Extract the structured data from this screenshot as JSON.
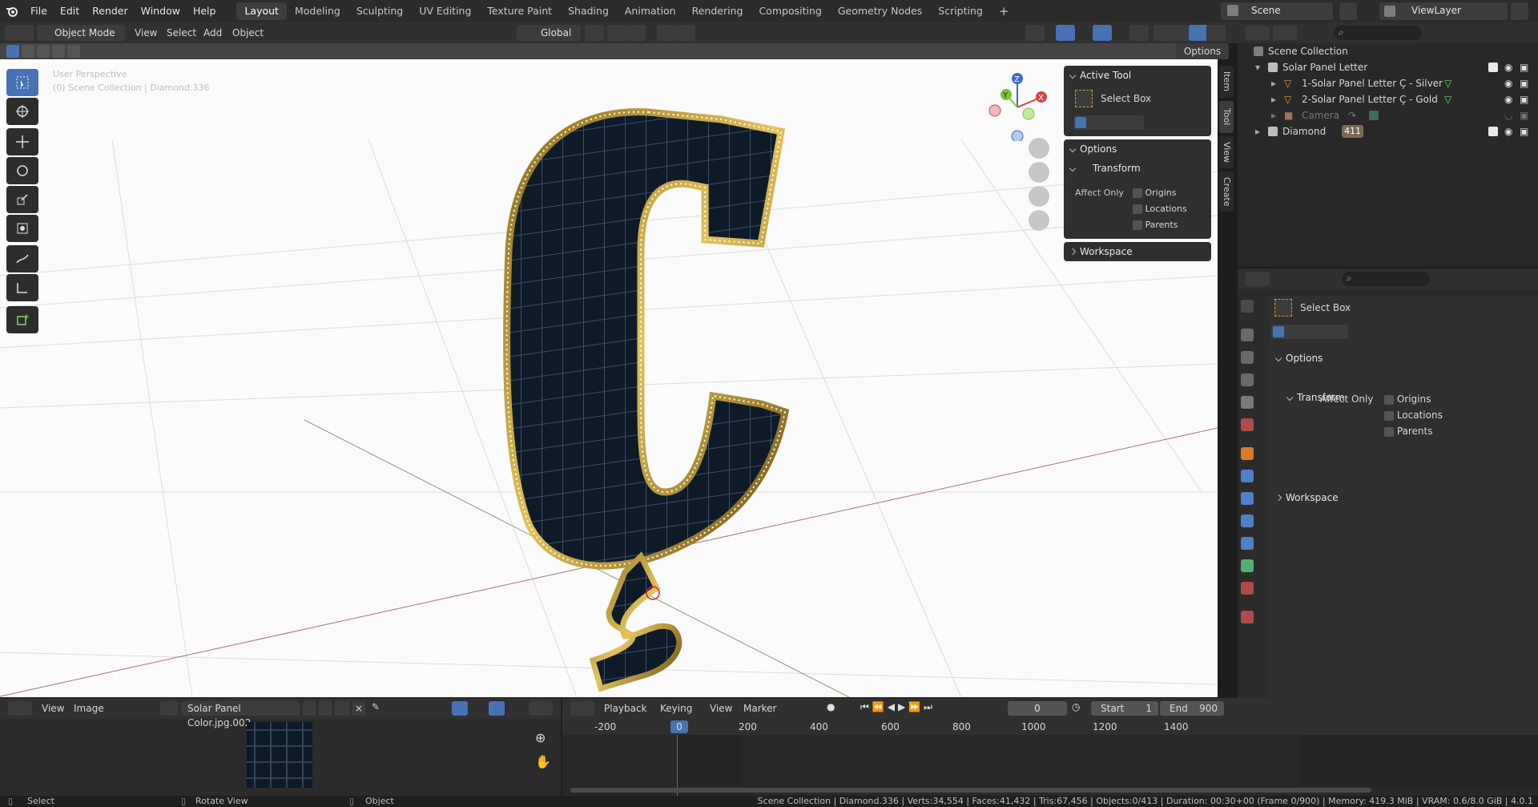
{
  "menubar": {
    "items": [
      "File",
      "Edit",
      "Render",
      "Window",
      "Help"
    ],
    "workspaces": [
      "Layout",
      "Modeling",
      "Sculpting",
      "UV Editing",
      "Texture Paint",
      "Shading",
      "Animation",
      "Rendering",
      "Compositing",
      "Geometry Nodes",
      "Scripting"
    ],
    "active_workspace": "Layout",
    "scene": "Scene",
    "view_layer": "ViewLayer"
  },
  "viewport_header": {
    "mode": "Object Mode",
    "menus": [
      "View",
      "Select",
      "Add",
      "Object"
    ],
    "orientation": "Global",
    "options_label": "Options"
  },
  "viewport": {
    "perspective_label": "User Perspective",
    "collection_label": "(0) Scene Collection | Diamond.336",
    "gizmo_axes": [
      "Z",
      "Y",
      "X"
    ]
  },
  "npanel": {
    "active_tool_header": "Active Tool",
    "tool_name": "Select Box",
    "options_header": "Options",
    "transform_header": "Transform",
    "affect_only": "Affect Only",
    "checkboxes": [
      "Origins",
      "Locations",
      "Parents"
    ],
    "workspace_header": "Workspace",
    "tabs": [
      "Item",
      "Tool",
      "View",
      "Create"
    ]
  },
  "outliner": {
    "root": "Scene Collection",
    "items": [
      {
        "label": "Solar Panel Letter",
        "level": 1
      },
      {
        "label": "1-Solar Panel Letter Ç - Silver",
        "level": 2
      },
      {
        "label": "2-Solar Panel Letter Ç - Gold",
        "level": 2
      },
      {
        "label": "Camera",
        "level": 2
      },
      {
        "label": "Diamond",
        "level": 1
      }
    ],
    "diamond_badge": "411"
  },
  "properties": {
    "tool_name": "Select Box",
    "options_header": "Options",
    "transform_header": "Transform",
    "affect_only": "Affect Only",
    "checkboxes": [
      "Origins",
      "Locations",
      "Parents"
    ],
    "workspace_header": "Workspace"
  },
  "image_editor": {
    "menus": [
      "View",
      "Image"
    ],
    "image_name": "Solar Panel Color.jpg.002"
  },
  "timeline": {
    "menus": [
      "Playback",
      "Keying",
      "View",
      "Marker"
    ],
    "current_frame": "0",
    "start_label": "Start",
    "start_value": "1",
    "end_label": "End",
    "end_value": "900",
    "ruler": [
      "-200",
      "0",
      "200",
      "400",
      "600",
      "800",
      "1000",
      "1200",
      "1400"
    ]
  },
  "status_bar": {
    "select": "Select",
    "rotate": "Rotate View",
    "object": "Object",
    "stats": "Scene Collection | Diamond.336 | Verts:34,554 | Faces:41,432 | Tris:67,456 | Objects:0/413 | Duration: 00:30+00 (Frame 0/900) | Memory: 419.3 MiB | VRAM: 0.6/8.0 GiB | 4.0.1"
  },
  "colors": {
    "accent": "#4772b3",
    "panel": "#2b2b2b",
    "viewport_bg": "#fbfbfb",
    "gold": "#c9a227"
  }
}
